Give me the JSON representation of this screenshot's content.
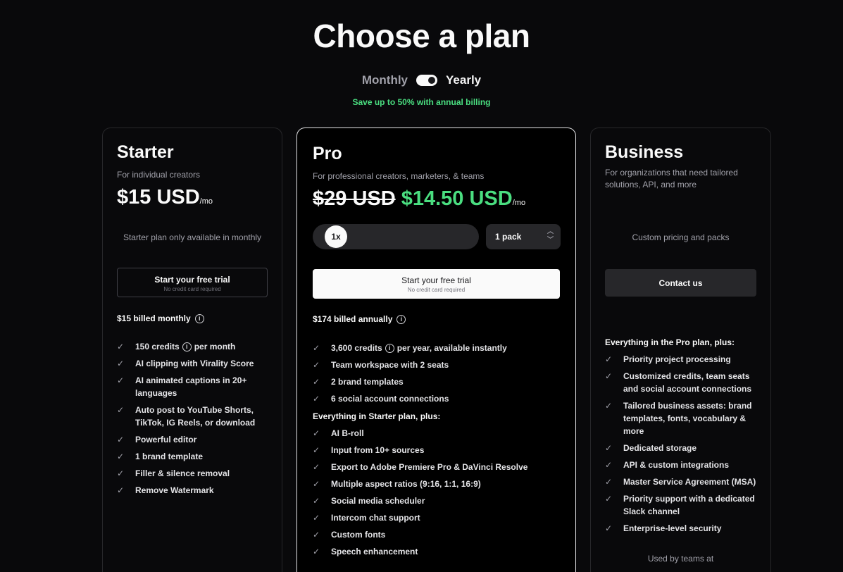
{
  "header": {
    "title": "Choose a plan",
    "toggle": {
      "monthly_label": "Monthly",
      "yearly_label": "Yearly",
      "selected": "Yearly"
    },
    "save_note": "Save up to 50% with annual billing"
  },
  "plans": {
    "starter": {
      "name": "Starter",
      "description": "For individual creators",
      "price": "$15 USD",
      "per": "/mo",
      "note": "Starter plan only available in monthly",
      "cta": {
        "label": "Start your free trial",
        "sub": "No credit card required"
      },
      "billed": "$15 billed monthly",
      "features": [
        {
          "text": "150 credits",
          "after": "per month"
        },
        {
          "text": "AI clipping with Virality Score"
        },
        {
          "text": "AI animated captions in 20+ languages"
        },
        {
          "text": "Auto post to YouTube Shorts, TikTok, IG Reels, or download"
        },
        {
          "text": "Powerful editor"
        },
        {
          "text": "1 brand template"
        },
        {
          "text": "Filler & silence removal"
        },
        {
          "text": "Remove Watermark"
        }
      ]
    },
    "pro": {
      "name": "Pro",
      "description": "For professional creators, marketers, & teams",
      "old_price": "$29 USD",
      "price": "$14.50 USD",
      "per": "/mo",
      "multiplier": "1x",
      "pack": "1 pack",
      "cta": {
        "label": "Start your free trial",
        "sub": "No credit card required"
      },
      "billed": "$174 billed annually",
      "features": [
        {
          "text": "3,600 credits",
          "after": "per year, available instantly"
        },
        {
          "text": "Team workspace with 2 seats"
        },
        {
          "text": "2 brand templates"
        },
        {
          "text": "6 social account connections"
        }
      ],
      "section_label": "Everything in Starter plan, plus:",
      "extra_features": [
        {
          "text": "AI B-roll"
        },
        {
          "text": "Input from 10+ sources"
        },
        {
          "text": "Export to Adobe Premiere Pro & DaVinci Resolve"
        },
        {
          "text": "Multiple aspect ratios (9:16, 1:1, 16:9)"
        },
        {
          "text": "Social media scheduler"
        },
        {
          "text": "Intercom chat support"
        },
        {
          "text": "Custom fonts"
        },
        {
          "text": "Speech enhancement"
        }
      ]
    },
    "business": {
      "name": "Business",
      "description": "For organizations that need tailored solutions, API, and more",
      "note": "Custom pricing and packs",
      "cta": {
        "label": "Contact us"
      },
      "section_label": "Everything in the Pro plan, plus:",
      "features": [
        {
          "text": "Priority project processing"
        },
        {
          "text": "Customized credits, team seats and social account connections"
        },
        {
          "text": "Tailored business assets: brand templates, fonts, vocabulary & more"
        },
        {
          "text": "Dedicated storage"
        },
        {
          "text": "API & custom integrations"
        },
        {
          "text": "Master Service Agreement (MSA)"
        },
        {
          "text": "Priority support with a dedicated Slack channel"
        },
        {
          "text": "Enterprise-level security"
        }
      ],
      "footer": "Used by teams at"
    }
  },
  "icons": {
    "check": "check-icon",
    "info": "info-icon",
    "chevron": "chevron-up-down-icon"
  },
  "colors": {
    "accent_green": "#4ade80",
    "background": "#09090b",
    "card_border": "#27272a"
  }
}
